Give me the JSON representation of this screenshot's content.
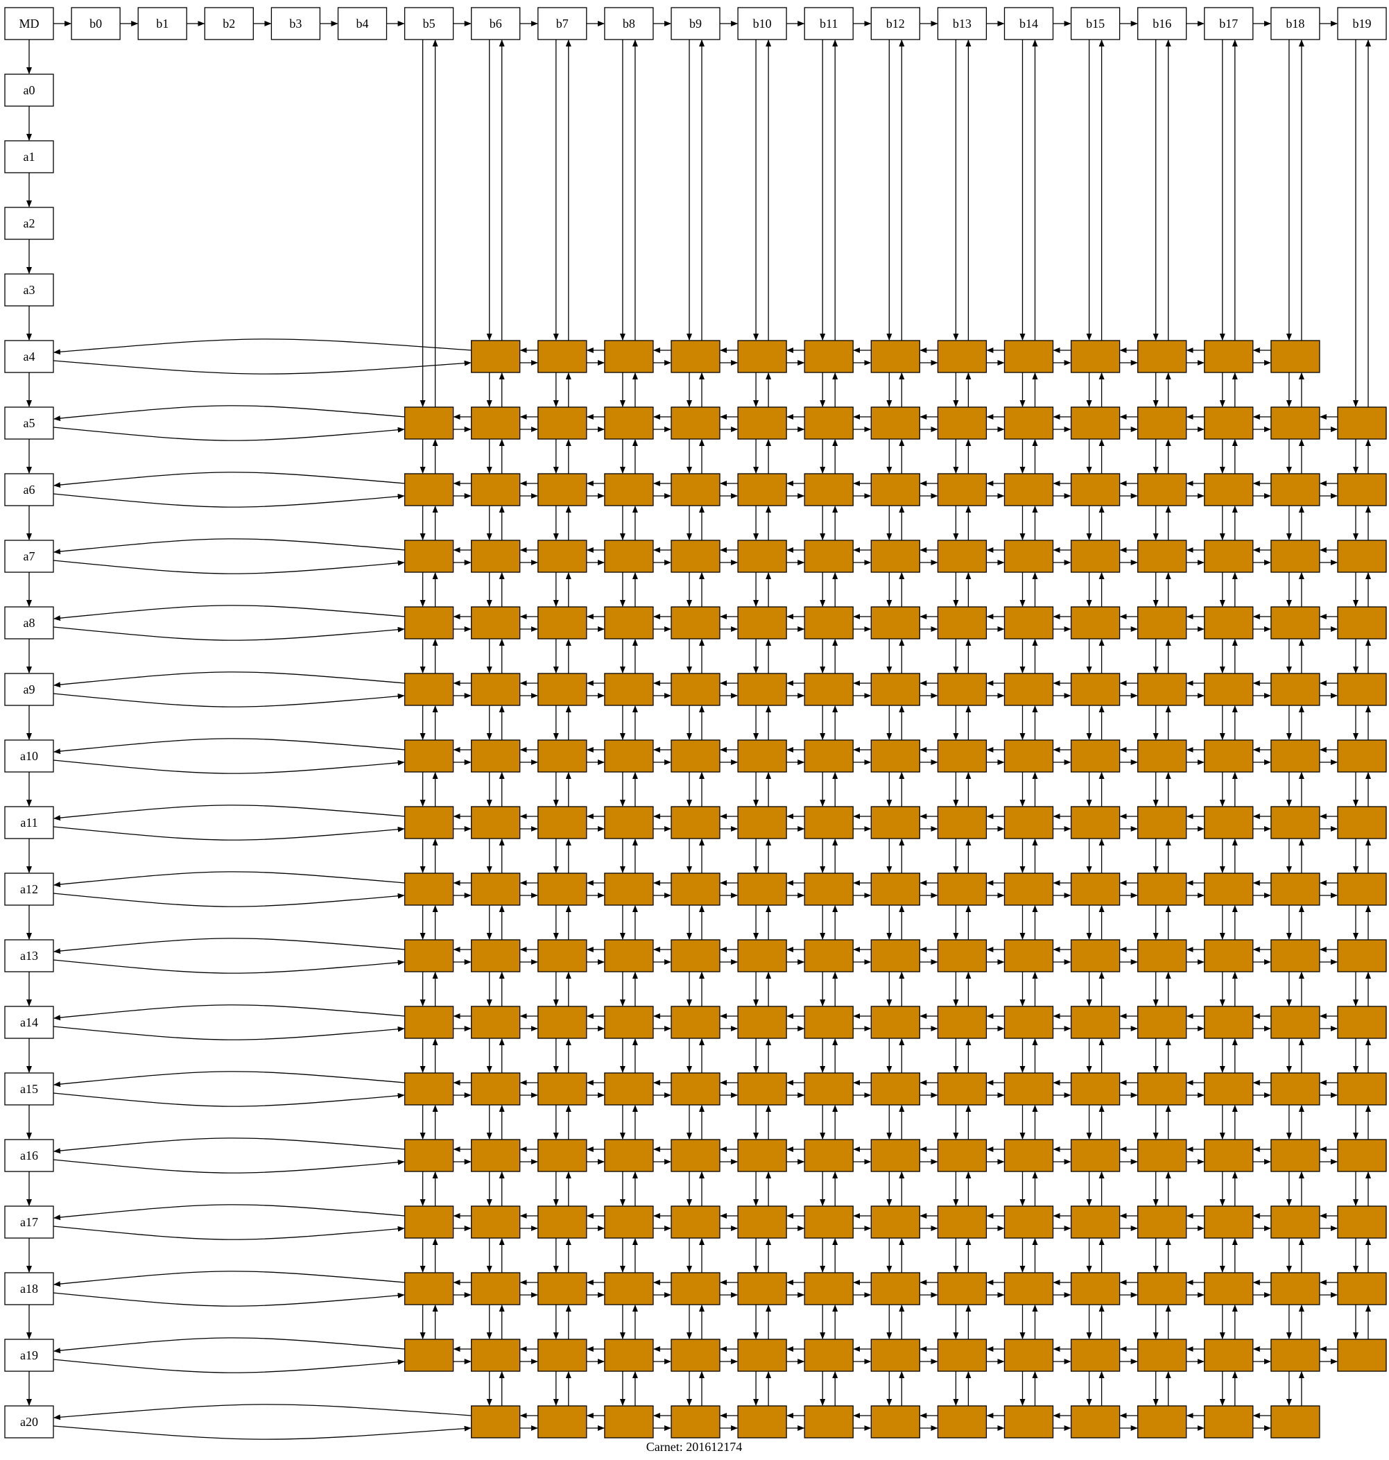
{
  "graph": {
    "root": {
      "label": "MD"
    },
    "columns": [
      "b0",
      "b1",
      "b2",
      "b3",
      "b4",
      "b5",
      "b6",
      "b7",
      "b8",
      "b9",
      "b10",
      "b11",
      "b12",
      "b13",
      "b14",
      "b15",
      "b16",
      "b17",
      "b18",
      "b19"
    ],
    "rows": [
      "a0",
      "a1",
      "a2",
      "a3",
      "a4",
      "a5",
      "a6",
      "a7",
      "a8",
      "a9",
      "a10",
      "a11",
      "a12",
      "a13",
      "a14",
      "a15",
      "a16",
      "a17",
      "a18",
      "a19",
      "a20"
    ],
    "row_cell_ranges": {
      "a4": [
        "b6",
        "b18"
      ],
      "a5": [
        "b5",
        "b19"
      ],
      "a6": [
        "b5",
        "b19"
      ],
      "a7": [
        "b5",
        "b19"
      ],
      "a8": [
        "b5",
        "b19"
      ],
      "a9": [
        "b5",
        "b19"
      ],
      "a10": [
        "b5",
        "b19"
      ],
      "a11": [
        "b5",
        "b19"
      ],
      "a12": [
        "b5",
        "b19"
      ],
      "a13": [
        "b5",
        "b19"
      ],
      "a14": [
        "b5",
        "b19"
      ],
      "a15": [
        "b5",
        "b19"
      ],
      "a16": [
        "b5",
        "b19"
      ],
      "a17": [
        "b5",
        "b19"
      ],
      "a18": [
        "b5",
        "b19"
      ],
      "a19": [
        "b5",
        "b19"
      ],
      "a20": [
        "b6",
        "b18"
      ]
    },
    "cell_fill": "#cd8500",
    "header_fill": "#ffffff",
    "edge_color": "#000000"
  },
  "caption": "Carnet: 201612174"
}
